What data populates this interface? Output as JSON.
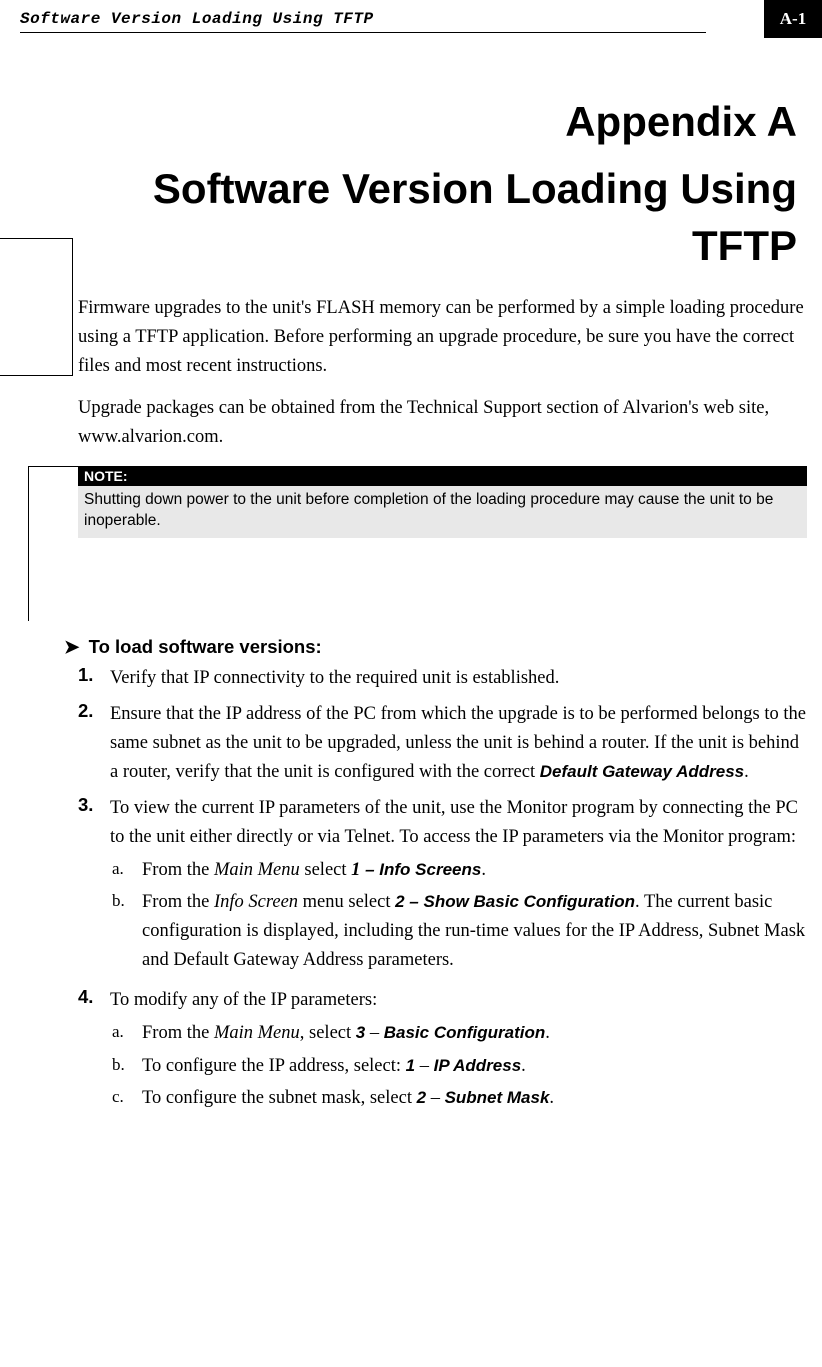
{
  "header": {
    "running_title": "Software Version Loading Using TFTP",
    "page_number": "A-1"
  },
  "chapter_title": "Appendix A",
  "section_title": "Software Version Loading Using TFTP",
  "paragraphs": [
    "Firmware upgrades to the unit's FLASH memory can be performed by a simple loading procedure using a TFTP application. Before performing an upgrade procedure, be sure you have the correct files and most recent instructions.",
    "Upgrade packages can be obtained from the Technical Support section of Alvarion's web site, www.alvarion.com."
  ],
  "note": {
    "label": "NOTE:",
    "content": "Shutting down power to the unit before completion of the loading procedure may cause the unit to be inoperable."
  },
  "procedure_heading": "To load software versions:",
  "steps": [
    {
      "num": "1.",
      "text": "Verify that IP connectivity to the required unit is established."
    },
    {
      "num": "2.",
      "text_before": "Ensure that the IP address of the PC from which the upgrade is to be performed belongs to the same subnet as the unit to be upgraded, unless the unit is behind a router. If the unit is behind a router, verify that the unit is configured with the correct ",
      "bold_term": "Default Gateway Address",
      "text_after": "."
    },
    {
      "num": "3.",
      "text": "To view the current IP parameters of the unit, use the Monitor program by connecting the PC to the unit either directly or via Telnet. To access the IP parameters via the Monitor program:",
      "subs": [
        {
          "letter": "a.",
          "prefix": "From the ",
          "italic1": "Main Menu",
          "mid1": " select ",
          "mnum": "1",
          "bold": " – Info Screens",
          "suffix": "."
        },
        {
          "letter": "b.",
          "prefix": "From the ",
          "italic1": "Info Screen",
          "mid1": " menu select ",
          "bold": "2 – Show Basic Configuration",
          "suffix": ". The current basic configuration is displayed, including the run-time values for the IP Address, Subnet Mask and Default Gateway Address parameters."
        }
      ]
    },
    {
      "num": "4.",
      "text": "To modify any of the IP parameters:",
      "subs": [
        {
          "letter": "a.",
          "prefix": "From the ",
          "italic1": "Main Menu",
          "mid1": ", select ",
          "bold_num": "3",
          "dash": " – ",
          "bold": "Basic Configuration",
          "suffix": "."
        },
        {
          "letter": "b.",
          "prefix": "To configure the IP address, select: ",
          "bold_num": "1",
          "dash": " – ",
          "bold": "IP Address",
          "suffix": "."
        },
        {
          "letter": "c.",
          "prefix": "To configure the subnet mask, select ",
          "bold_num": "2",
          "dash": " – ",
          "bold": "Subnet Mask",
          "suffix": "."
        }
      ]
    }
  ]
}
